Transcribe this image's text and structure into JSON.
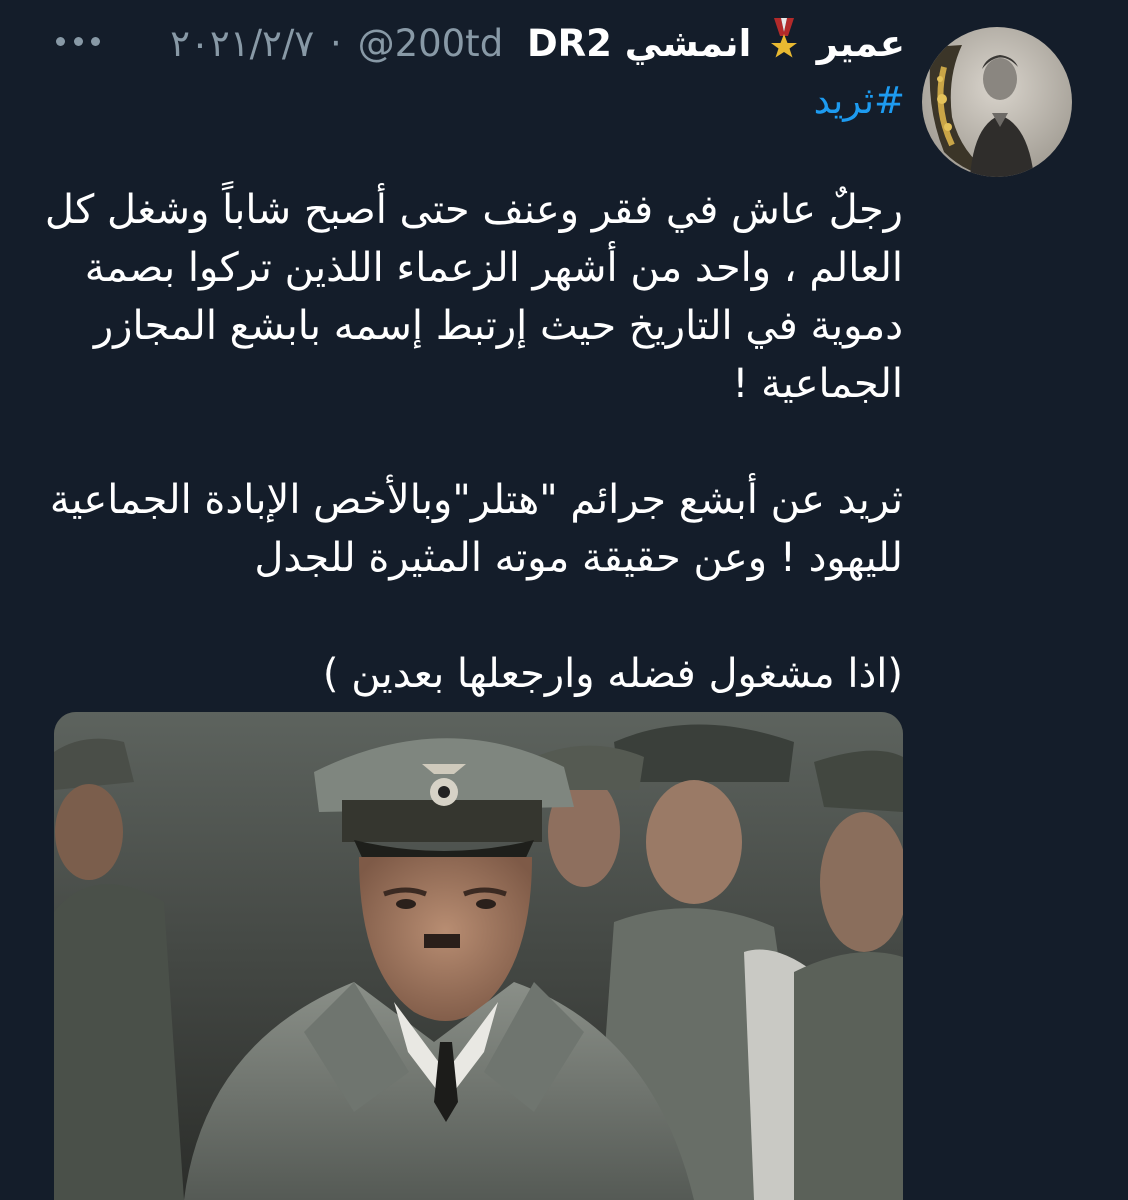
{
  "tweet": {
    "display_name": "عمير",
    "medal_icon": "medal-icon",
    "name_suffix": "انمشي DR2",
    "handle": "@200td",
    "separator": "·",
    "date": "٢٠٢١/٢/٧",
    "hashtag": "#ثريد",
    "paragraph1": "رجلٌ عاش في فقر وعنف حتى أصبح شاباً وشغل كل العالم ، واحد من أشهر الزعماء اللذين تركوا بصمة دموية في التاريخ حيث إرتبط إسمه بابشع المجازر الجماعية !",
    "paragraph2": "ثريد عن أبشع جرائم \"هتلر\"وبالأخص الإبادة الجماعية لليهود ! وعن حقيقة موته المثيرة للجدل",
    "paragraph3": "(اذا مشغول فضله وارجعلها بعدين )"
  },
  "colors": {
    "background": "#141d2a",
    "text": "#ffffff",
    "secondary": "#8899a6",
    "link": "#1d9bf0"
  }
}
